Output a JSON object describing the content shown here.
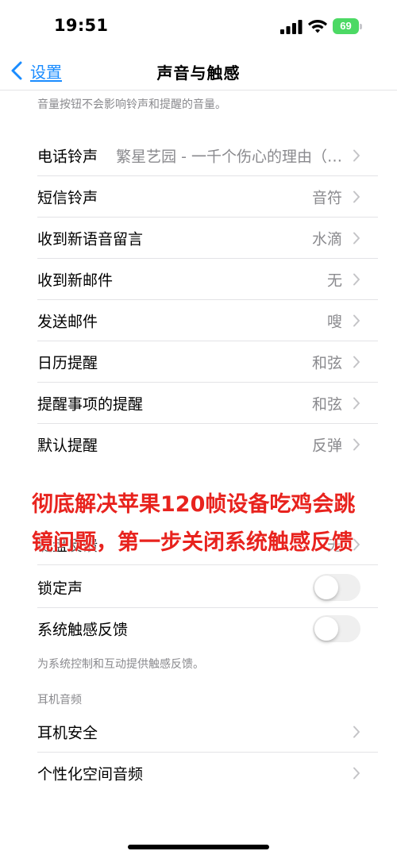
{
  "status": {
    "time": "19:51",
    "battery": "69"
  },
  "nav": {
    "back_label": "设置",
    "title": "声音与触感"
  },
  "ringer_footnote": "音量按钮不会影响铃声和提醒的音量。",
  "sounds": [
    {
      "label": "电话铃声",
      "value": "繁星艺园 - 一千个伤心的理由（…"
    },
    {
      "label": "短信铃声",
      "value": "音符"
    },
    {
      "label": "收到新语音留言",
      "value": "水滴"
    },
    {
      "label": "收到新邮件",
      "value": "无"
    },
    {
      "label": "发送邮件",
      "value": "嗖"
    },
    {
      "label": "日历提醒",
      "value": "和弦"
    },
    {
      "label": "提醒事项的提醒",
      "value": "和弦"
    },
    {
      "label": "默认提醒",
      "value": "反弹"
    }
  ],
  "overlay": {
    "line1": "彻底解决苹果120帧设备吃鸡会跳",
    "line2": "镜问题，第一步关闭系统触感反馈"
  },
  "feedback": [
    {
      "label": "键盘反馈",
      "value": "无"
    },
    {
      "label": "锁定声",
      "toggle": "off"
    },
    {
      "label": "系统触感反馈",
      "toggle": "off"
    }
  ],
  "haptics_footnote": "为系统控制和互动提供触感反馈。",
  "headphone": {
    "header": "耳机音频",
    "items": [
      {
        "label": "耳机安全"
      },
      {
        "label": "个性化空间音频"
      }
    ]
  }
}
